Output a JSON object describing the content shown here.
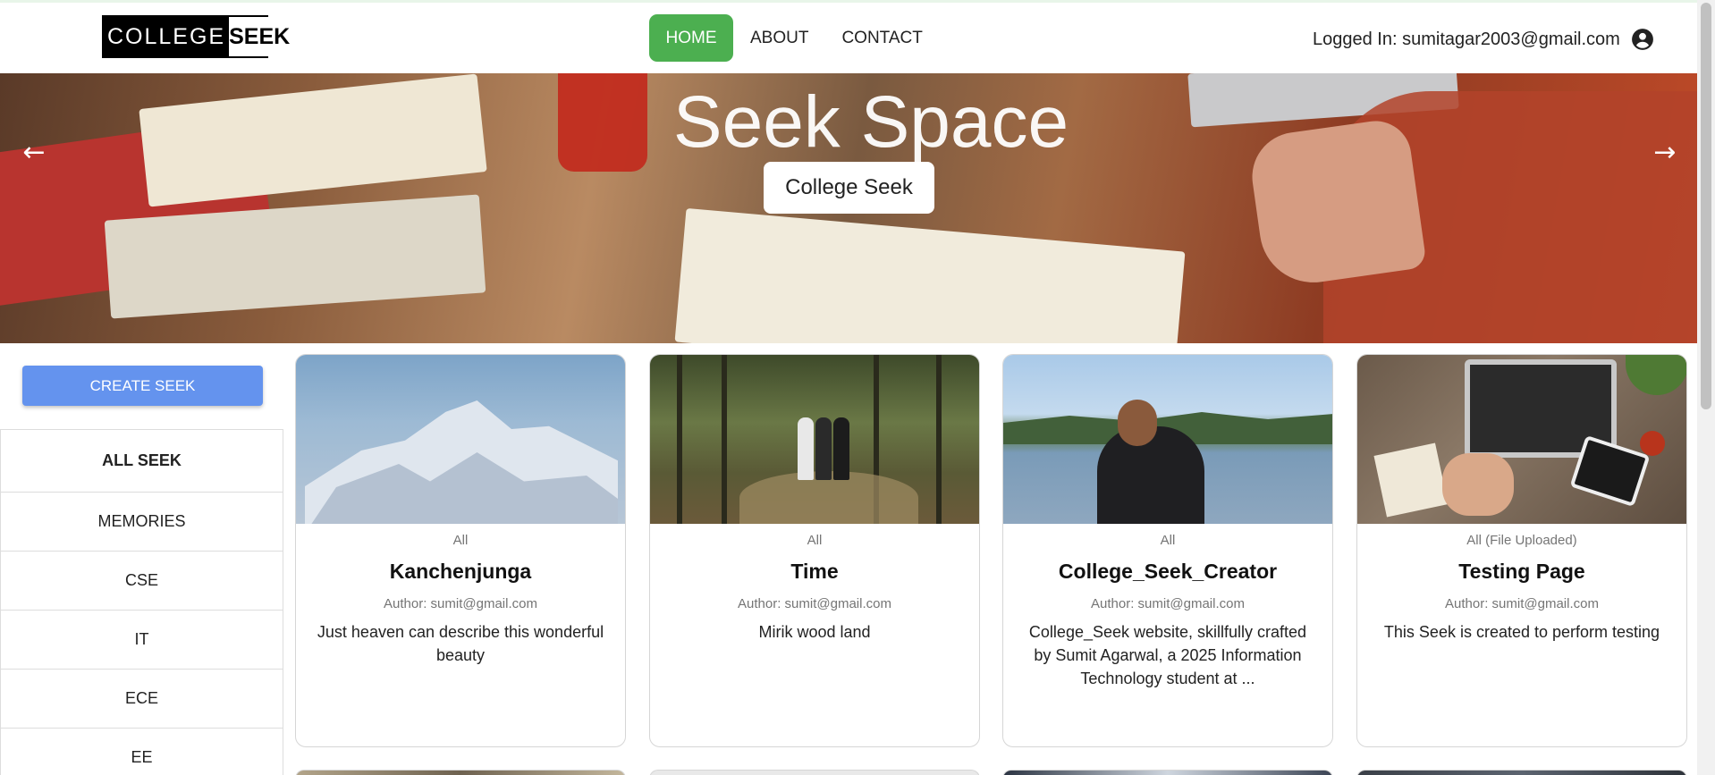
{
  "navbar": {
    "logo_left": "COLLEGE",
    "logo_right": "SEEK",
    "links": {
      "home": "HOME",
      "about": "ABOUT",
      "contact": "CONTACT"
    },
    "user_label": "Logged In: sumitagar2003@gmail.com"
  },
  "hero": {
    "title": "Seek Space",
    "badge": "College Seek",
    "prev_glyph": "←",
    "next_glyph": "→"
  },
  "sidebar": {
    "create_button": "CREATE SEEK",
    "categories": [
      "ALL SEEK",
      "MEMORIES",
      "CSE",
      "IT",
      "ECE",
      "EE"
    ]
  },
  "cards": [
    {
      "category": "All",
      "title": "Kanchenjunga",
      "author": "Author: sumit@gmail.com",
      "description": "Just heaven can describe this wonderful beauty"
    },
    {
      "category": "All",
      "title": "Time",
      "author": "Author: sumit@gmail.com",
      "description": "Mirik wood land"
    },
    {
      "category": "All",
      "title": "College_Seek_Creator",
      "author": "Author: sumit@gmail.com",
      "description": "College_Seek website, skillfully crafted by Sumit Agarwal, a 2025 Information Technology student at ..."
    },
    {
      "category": "All (File Uploaded)",
      "title": "Testing Page",
      "author": "Author: sumit@gmail.com",
      "description": "This Seek is created to perform testing"
    }
  ],
  "colors": {
    "home_active": "#4caf50",
    "create_button": "#6493ee"
  }
}
